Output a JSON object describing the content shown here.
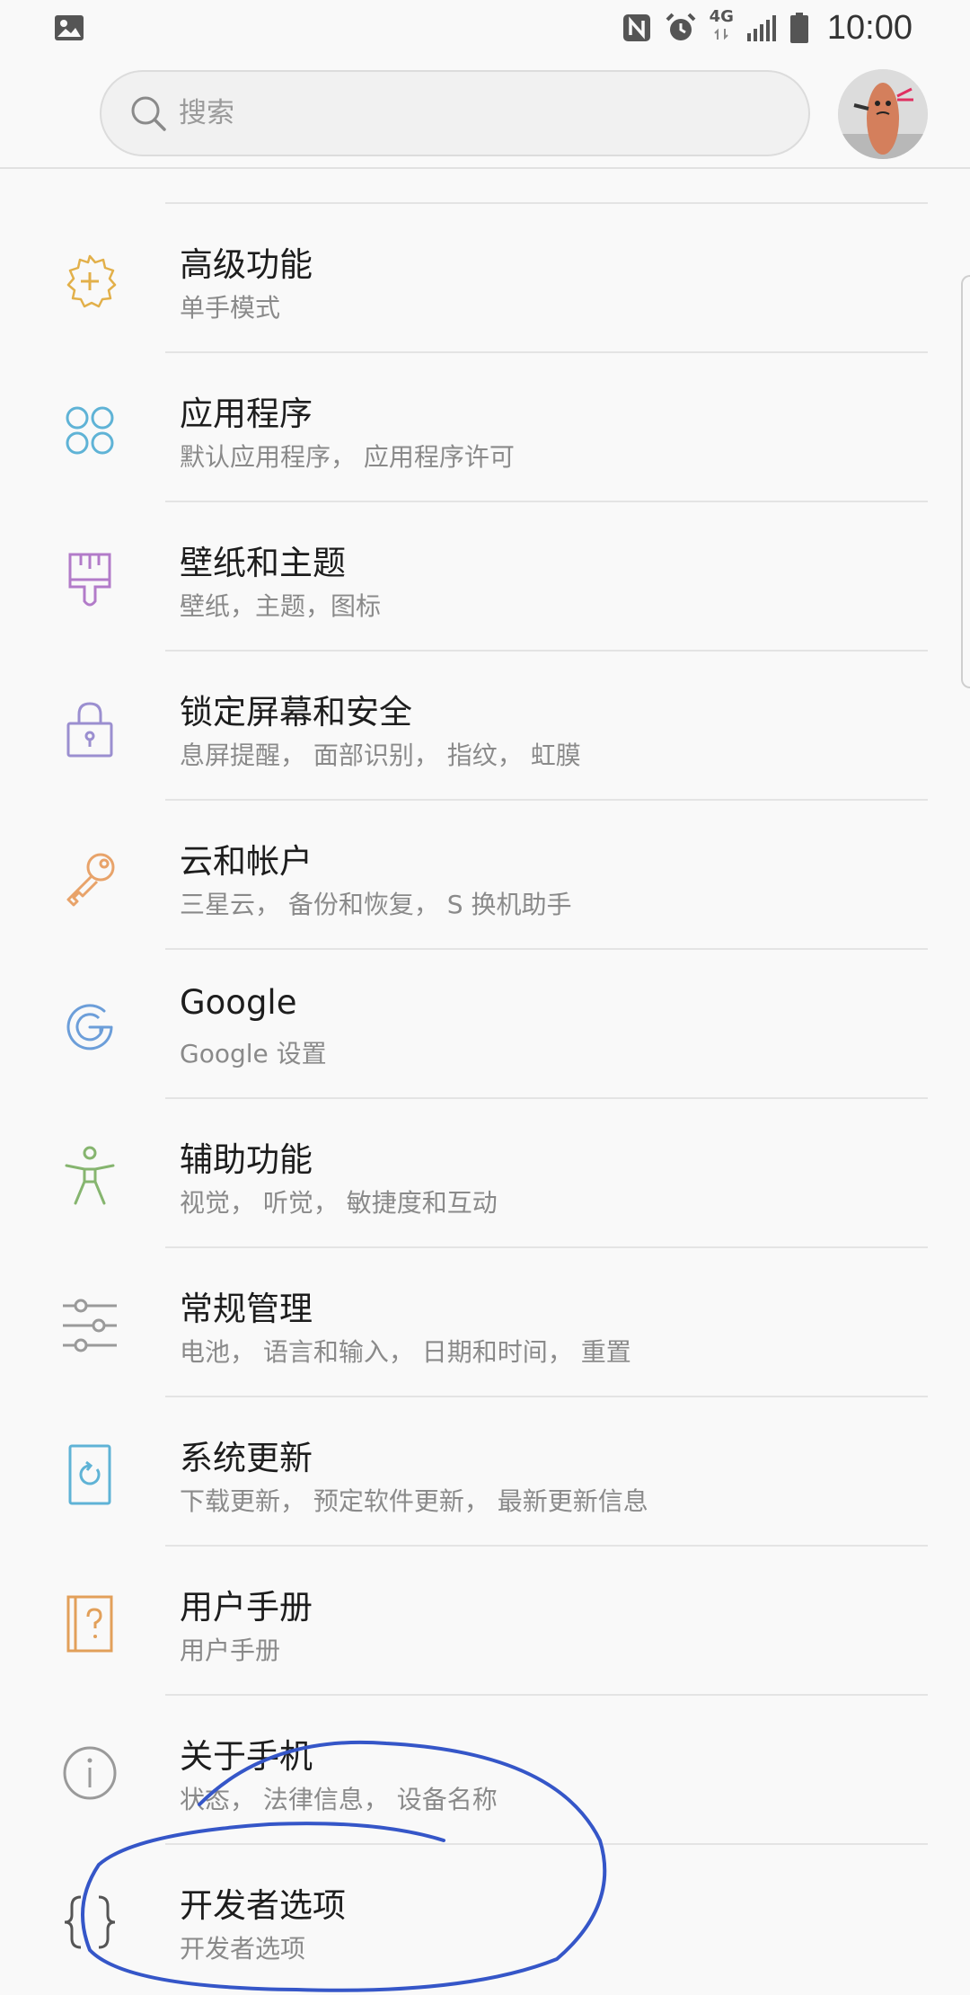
{
  "status_bar": {
    "time": "10:00",
    "network": "4G",
    "icons": [
      "gallery-icon",
      "nfc-icon",
      "alarm-icon",
      "data-arrows-icon",
      "signal-icon",
      "battery-icon"
    ]
  },
  "search": {
    "placeholder": "搜索"
  },
  "settings_items": [
    {
      "title": "高级功能",
      "subtitle": "单手模式",
      "icon": "gear-plus-icon",
      "color": "#e2b04a"
    },
    {
      "title": "应用程序",
      "subtitle": "默认应用程序， 应用程序许可",
      "icon": "apps-icon",
      "color": "#5fb3d6"
    },
    {
      "title": "壁纸和主题",
      "subtitle": "壁纸，主题，图标",
      "icon": "paintbrush-icon",
      "color": "#b27bc9"
    },
    {
      "title": "锁定屏幕和安全",
      "subtitle": "息屏提醒， 面部识别， 指纹， 虹膜",
      "icon": "lock-icon",
      "color": "#9b8fd0"
    },
    {
      "title": "云和帐户",
      "subtitle": "三星云， 备份和恢复， S 换机助手",
      "icon": "key-icon",
      "color": "#e8a36a"
    },
    {
      "title": "Google",
      "subtitle": "Google 设置",
      "icon": "google-icon",
      "color": "#6c9ed9"
    },
    {
      "title": "辅助功能",
      "subtitle": "视觉， 听觉， 敏捷度和互动",
      "icon": "accessibility-icon",
      "color": "#86b56f"
    },
    {
      "title": "常规管理",
      "subtitle": "电池， 语言和输入， 日期和时间， 重置",
      "icon": "sliders-icon",
      "color": "#9a9a9a"
    },
    {
      "title": "系统更新",
      "subtitle": "下载更新， 预定软件更新， 最新更新信息",
      "icon": "system-update-icon",
      "color": "#5fb3d6"
    },
    {
      "title": "用户手册",
      "subtitle": "用户手册",
      "icon": "manual-icon",
      "color": "#e2a05a"
    },
    {
      "title": "关于手机",
      "subtitle": "状态， 法律信息， 设备名称",
      "icon": "info-icon",
      "color": "#9a9a9a"
    },
    {
      "title": "开发者选项",
      "subtitle": "开发者选项",
      "icon": "braces-icon",
      "color": "#555555"
    }
  ],
  "annotation_color": "#3556c8"
}
